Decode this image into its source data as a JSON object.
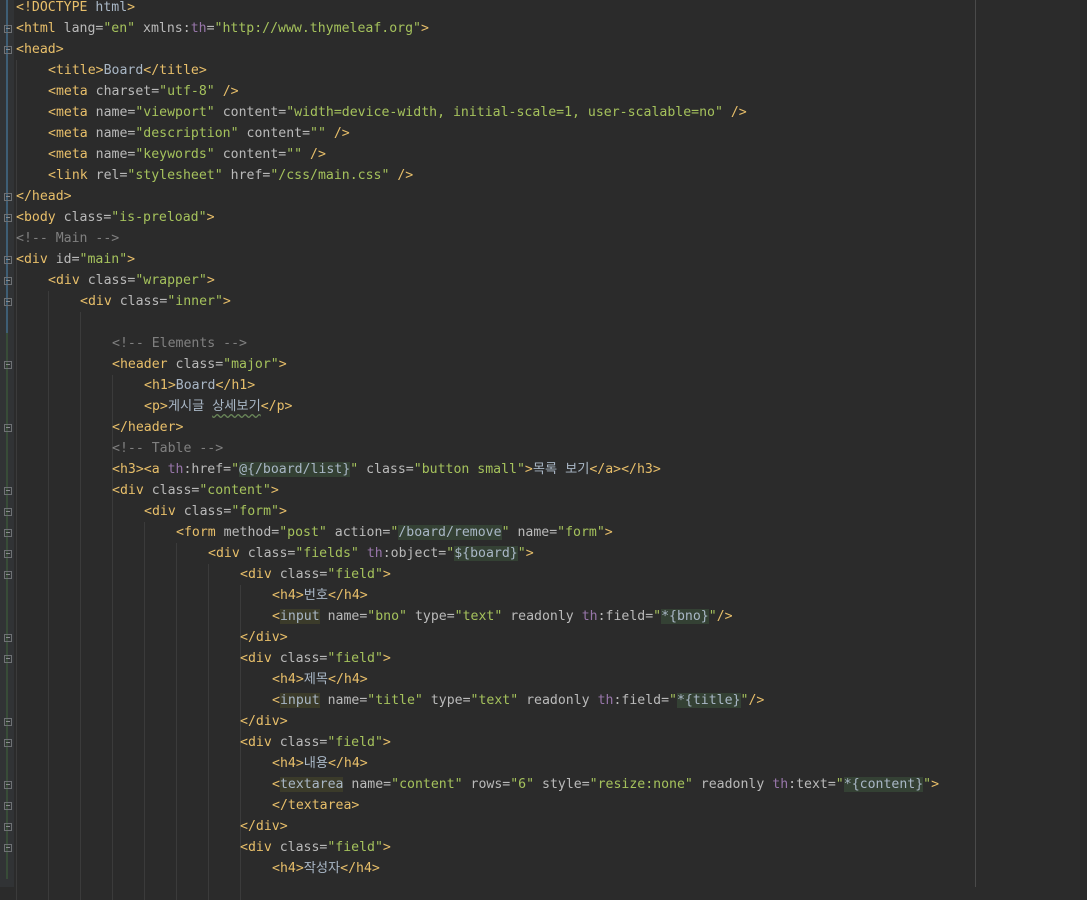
{
  "editor": {
    "language": "html",
    "colors": {
      "background": "#2b2b2b",
      "tag": "#e8bf6a",
      "attribute": "#bababa",
      "value": "#a5c25c",
      "comment": "#808080",
      "text": "#a9b7c6",
      "namespace": "#9876aa"
    },
    "lines": [
      {
        "indent": 0,
        "fold": false,
        "change": "mod",
        "tokens": [
          [
            "t",
            "<!DOCTYPE "
          ],
          [
            "x",
            "html"
          ],
          [
            "t",
            ">"
          ]
        ]
      },
      {
        "indent": 0,
        "fold": true,
        "change": "mod",
        "tokens": [
          [
            "t",
            "<html "
          ],
          [
            "a",
            "lang="
          ],
          [
            "v",
            "\"en\""
          ],
          [
            "a",
            " xmlns:"
          ],
          [
            "ns",
            "th"
          ],
          [
            "a",
            "="
          ],
          [
            "v",
            "\"http://www.thymeleaf.org\""
          ],
          [
            "t",
            ">"
          ]
        ]
      },
      {
        "indent": 0,
        "fold": true,
        "change": "mod",
        "tokens": [
          [
            "t",
            "<head>"
          ]
        ]
      },
      {
        "indent": 1,
        "fold": false,
        "change": "mod",
        "tokens": [
          [
            "t",
            "<title>"
          ],
          [
            "x",
            "Board"
          ],
          [
            "t",
            "</title>"
          ]
        ]
      },
      {
        "indent": 1,
        "fold": false,
        "change": "mod",
        "tokens": [
          [
            "t",
            "<meta "
          ],
          [
            "a",
            "charset="
          ],
          [
            "v",
            "\"utf-8\""
          ],
          [
            "t",
            " />"
          ]
        ]
      },
      {
        "indent": 1,
        "fold": false,
        "change": "mod",
        "tokens": [
          [
            "t",
            "<meta "
          ],
          [
            "a",
            "name="
          ],
          [
            "v",
            "\"viewport\""
          ],
          [
            "a",
            " content="
          ],
          [
            "v",
            "\"width=device-width, initial-scale=1, user-scalable=no\""
          ],
          [
            "t",
            " />"
          ]
        ]
      },
      {
        "indent": 1,
        "fold": false,
        "change": "mod",
        "tokens": [
          [
            "t",
            "<meta "
          ],
          [
            "a",
            "name="
          ],
          [
            "v",
            "\"description\""
          ],
          [
            "a",
            " content="
          ],
          [
            "v",
            "\"\""
          ],
          [
            "t",
            " />"
          ]
        ]
      },
      {
        "indent": 1,
        "fold": false,
        "change": "mod",
        "tokens": [
          [
            "t",
            "<meta "
          ],
          [
            "a",
            "name="
          ],
          [
            "v",
            "\"keywords\""
          ],
          [
            "a",
            " content="
          ],
          [
            "v",
            "\"\""
          ],
          [
            "t",
            " />"
          ]
        ]
      },
      {
        "indent": 1,
        "fold": false,
        "change": "mod",
        "tokens": [
          [
            "t",
            "<link "
          ],
          [
            "a",
            "rel="
          ],
          [
            "v",
            "\"stylesheet\""
          ],
          [
            "a",
            " href="
          ],
          [
            "v",
            "\"/css/main.css\""
          ],
          [
            "t",
            " />"
          ]
        ]
      },
      {
        "indent": 0,
        "fold": true,
        "change": "mod",
        "tokens": [
          [
            "t",
            "</head>"
          ]
        ]
      },
      {
        "indent": 0,
        "fold": true,
        "change": "mod",
        "tokens": [
          [
            "t",
            "<body "
          ],
          [
            "a",
            "class="
          ],
          [
            "v",
            "\"is-preload\""
          ],
          [
            "t",
            ">"
          ]
        ]
      },
      {
        "indent": 0,
        "fold": false,
        "change": "mod",
        "tokens": [
          [
            "c",
            "<!-- Main -->"
          ]
        ]
      },
      {
        "indent": 0,
        "fold": true,
        "change": "mod",
        "tokens": [
          [
            "t",
            "<div "
          ],
          [
            "a",
            "id="
          ],
          [
            "v",
            "\"main\""
          ],
          [
            "t",
            ">"
          ]
        ]
      },
      {
        "indent": 1,
        "fold": true,
        "change": "mod",
        "tokens": [
          [
            "t",
            "<div "
          ],
          [
            "a",
            "class="
          ],
          [
            "v",
            "\"wrapper\""
          ],
          [
            "t",
            ">"
          ]
        ]
      },
      {
        "indent": 2,
        "fold": true,
        "change": "mod",
        "tokens": [
          [
            "t",
            "<div "
          ],
          [
            "a",
            "class="
          ],
          [
            "v",
            "\"inner\""
          ],
          [
            "t",
            ">"
          ]
        ]
      },
      {
        "indent": 3,
        "fold": false,
        "change": "mod",
        "tokens": []
      },
      {
        "indent": 3,
        "fold": false,
        "change": "add",
        "tokens": [
          [
            "c",
            "<!-- Elements -->"
          ]
        ]
      },
      {
        "indent": 3,
        "fold": true,
        "change": "add",
        "tokens": [
          [
            "t",
            "<header "
          ],
          [
            "a",
            "class="
          ],
          [
            "v",
            "\"major\""
          ],
          [
            "t",
            ">"
          ]
        ]
      },
      {
        "indent": 4,
        "fold": false,
        "change": "add",
        "tokens": [
          [
            "t",
            "<h1>"
          ],
          [
            "x",
            "Board"
          ],
          [
            "t",
            "</h1>"
          ]
        ]
      },
      {
        "indent": 4,
        "fold": false,
        "change": "add",
        "tokens": [
          [
            "t",
            "<p>"
          ],
          [
            "x",
            "게시글 "
          ],
          [
            "sq",
            "상세보기"
          ],
          [
            "t",
            "</p>"
          ]
        ]
      },
      {
        "indent": 3,
        "fold": true,
        "change": "add",
        "tokens": [
          [
            "t",
            "</header>"
          ]
        ]
      },
      {
        "indent": 3,
        "fold": false,
        "change": "add",
        "tokens": [
          [
            "c",
            "<!-- Table -->"
          ]
        ]
      },
      {
        "indent": 3,
        "fold": false,
        "change": "add",
        "tokens": [
          [
            "t",
            "<h3><a "
          ],
          [
            "ns",
            "th"
          ],
          [
            "a",
            ":href="
          ],
          [
            "v",
            "\""
          ],
          [
            "hl2",
            "@{/board/list}"
          ],
          [
            "v",
            "\""
          ],
          [
            "a",
            " class="
          ],
          [
            "v",
            "\"button small\""
          ],
          [
            "t",
            ">"
          ],
          [
            "x",
            "목록 보기"
          ],
          [
            "t",
            "</a></h3>"
          ]
        ]
      },
      {
        "indent": 3,
        "fold": true,
        "change": "add",
        "tokens": [
          [
            "t",
            "<div "
          ],
          [
            "a",
            "class="
          ],
          [
            "v",
            "\"content\""
          ],
          [
            "t",
            ">"
          ]
        ]
      },
      {
        "indent": 4,
        "fold": true,
        "change": "add",
        "tokens": [
          [
            "t",
            "<div "
          ],
          [
            "a",
            "class="
          ],
          [
            "v",
            "\"form\""
          ],
          [
            "t",
            ">"
          ]
        ]
      },
      {
        "indent": 5,
        "fold": true,
        "change": "add",
        "tokens": [
          [
            "t",
            "<form "
          ],
          [
            "a",
            "method="
          ],
          [
            "v",
            "\"post\""
          ],
          [
            "a",
            " action="
          ],
          [
            "v",
            "\""
          ],
          [
            "hl2",
            "/board/remove"
          ],
          [
            "v",
            "\""
          ],
          [
            "a",
            " name="
          ],
          [
            "v",
            "\"form\""
          ],
          [
            "t",
            ">"
          ]
        ]
      },
      {
        "indent": 6,
        "fold": true,
        "change": "add",
        "tokens": [
          [
            "t",
            "<div "
          ],
          [
            "a",
            "class="
          ],
          [
            "v",
            "\"fields\""
          ],
          [
            "a",
            " "
          ],
          [
            "ns",
            "th"
          ],
          [
            "a",
            ":object="
          ],
          [
            "v",
            "\""
          ],
          [
            "hl2",
            "${board}"
          ],
          [
            "v",
            "\""
          ],
          [
            "t",
            ">"
          ]
        ]
      },
      {
        "indent": 7,
        "fold": true,
        "change": "add",
        "tokens": [
          [
            "t",
            "<div "
          ],
          [
            "a",
            "class="
          ],
          [
            "v",
            "\"field\""
          ],
          [
            "t",
            ">"
          ]
        ]
      },
      {
        "indent": 8,
        "fold": false,
        "change": "add",
        "tokens": [
          [
            "t",
            "<h4>"
          ],
          [
            "x",
            "번호"
          ],
          [
            "t",
            "</h4>"
          ]
        ]
      },
      {
        "indent": 8,
        "fold": false,
        "change": "add",
        "tokens": [
          [
            "t",
            "<"
          ],
          [
            "hl",
            "input"
          ],
          [
            "a",
            " name="
          ],
          [
            "v",
            "\"bno\""
          ],
          [
            "a",
            " type="
          ],
          [
            "v",
            "\"text\""
          ],
          [
            "a",
            " readonly "
          ],
          [
            "ns",
            "th"
          ],
          [
            "a",
            ":field="
          ],
          [
            "v",
            "\""
          ],
          [
            "hl2",
            "*{bno}"
          ],
          [
            "v",
            "\""
          ],
          [
            "t",
            "/>"
          ]
        ]
      },
      {
        "indent": 7,
        "fold": true,
        "change": "add",
        "tokens": [
          [
            "t",
            "</div>"
          ]
        ]
      },
      {
        "indent": 7,
        "fold": true,
        "change": "add",
        "tokens": [
          [
            "t",
            "<div "
          ],
          [
            "a",
            "class="
          ],
          [
            "v",
            "\"field\""
          ],
          [
            "t",
            ">"
          ]
        ]
      },
      {
        "indent": 8,
        "fold": false,
        "change": "add",
        "tokens": [
          [
            "t",
            "<h4>"
          ],
          [
            "x",
            "제목"
          ],
          [
            "t",
            "</h4>"
          ]
        ]
      },
      {
        "indent": 8,
        "fold": false,
        "change": "add",
        "tokens": [
          [
            "t",
            "<"
          ],
          [
            "hl",
            "input"
          ],
          [
            "a",
            " name="
          ],
          [
            "v",
            "\"title\""
          ],
          [
            "a",
            " type="
          ],
          [
            "v",
            "\"text\""
          ],
          [
            "a",
            " readonly "
          ],
          [
            "ns",
            "th"
          ],
          [
            "a",
            ":field="
          ],
          [
            "v",
            "\""
          ],
          [
            "hl2",
            "*{title}"
          ],
          [
            "v",
            "\""
          ],
          [
            "t",
            "/>"
          ]
        ]
      },
      {
        "indent": 7,
        "fold": true,
        "change": "add",
        "tokens": [
          [
            "t",
            "</div>"
          ]
        ]
      },
      {
        "indent": 7,
        "fold": true,
        "change": "add",
        "tokens": [
          [
            "t",
            "<div "
          ],
          [
            "a",
            "class="
          ],
          [
            "v",
            "\"field\""
          ],
          [
            "t",
            ">"
          ]
        ]
      },
      {
        "indent": 8,
        "fold": false,
        "change": "add",
        "tokens": [
          [
            "t",
            "<h4>"
          ],
          [
            "x",
            "내용"
          ],
          [
            "t",
            "</h4>"
          ]
        ]
      },
      {
        "indent": 8,
        "fold": true,
        "change": "add",
        "tokens": [
          [
            "t",
            "<"
          ],
          [
            "hl",
            "textarea"
          ],
          [
            "a",
            " name="
          ],
          [
            "v",
            "\"content\""
          ],
          [
            "a",
            " rows="
          ],
          [
            "v",
            "\"6\""
          ],
          [
            "a",
            " style="
          ],
          [
            "v",
            "\"resize:none\""
          ],
          [
            "a",
            " readonly "
          ],
          [
            "ns",
            "th"
          ],
          [
            "a",
            ":text="
          ],
          [
            "v",
            "\""
          ],
          [
            "hl2",
            "*{content}"
          ],
          [
            "v",
            "\""
          ],
          [
            "t",
            ">"
          ]
        ]
      },
      {
        "indent": 8,
        "fold": true,
        "change": "add",
        "tokens": [
          [
            "t",
            "</textarea>"
          ]
        ]
      },
      {
        "indent": 7,
        "fold": true,
        "change": "add",
        "tokens": [
          [
            "t",
            "</div>"
          ]
        ]
      },
      {
        "indent": 7,
        "fold": true,
        "change": "add",
        "tokens": [
          [
            "t",
            "<div "
          ],
          [
            "a",
            "class="
          ],
          [
            "v",
            "\"field\""
          ],
          [
            "t",
            ">"
          ]
        ]
      },
      {
        "indent": 8,
        "fold": false,
        "change": "add",
        "tokens": [
          [
            "t",
            "<h4>"
          ],
          [
            "x",
            "작성자"
          ],
          [
            "t",
            "</h4>"
          ]
        ]
      }
    ]
  }
}
